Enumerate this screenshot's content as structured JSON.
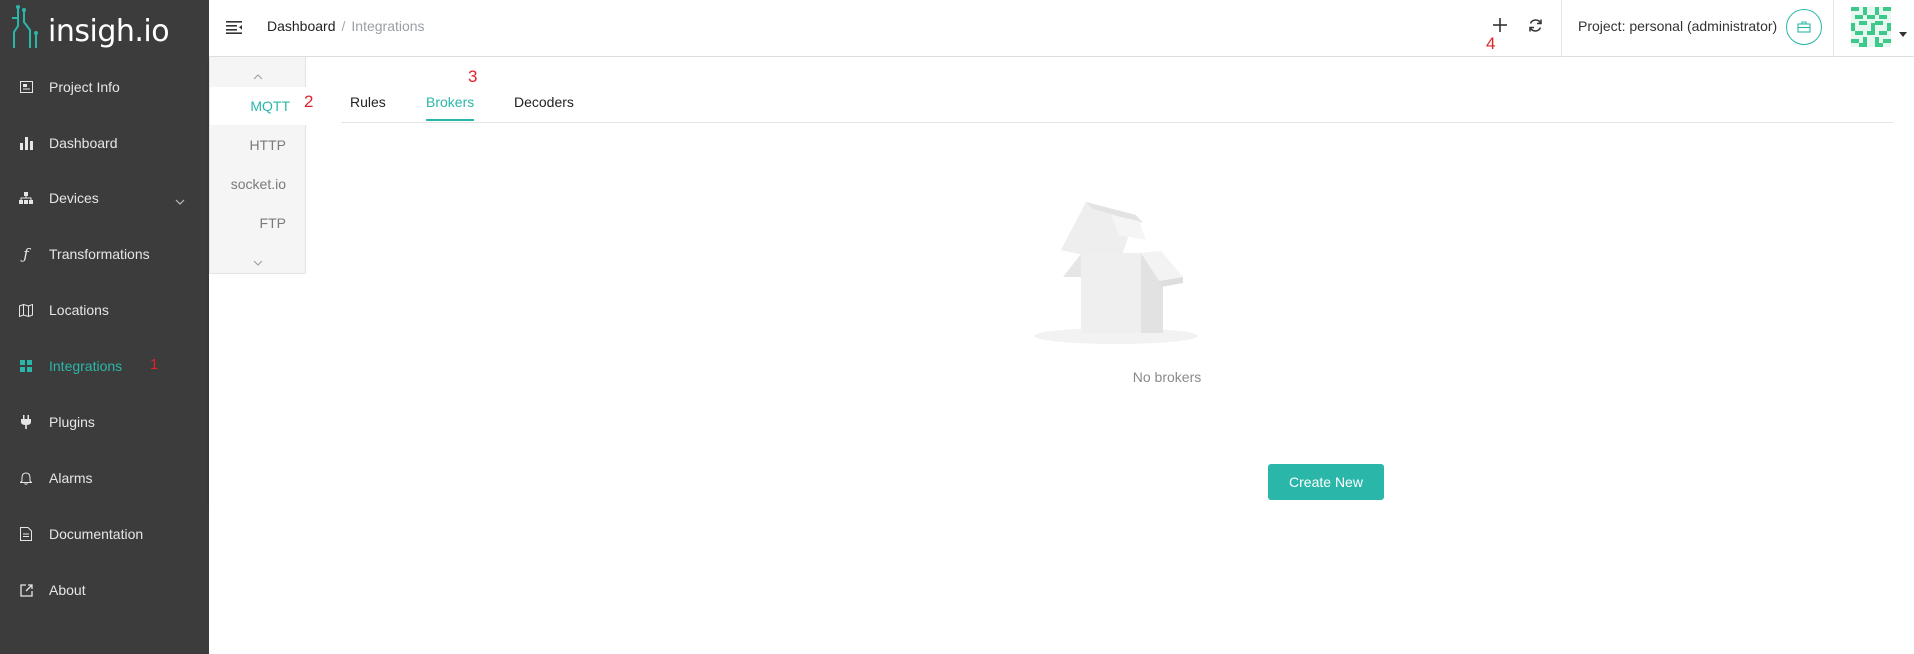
{
  "app": {
    "logo_text": "insigh.io"
  },
  "sidebar": {
    "items": [
      {
        "label": "Project Info",
        "icon": "project-info-icon"
      },
      {
        "label": "Dashboard",
        "icon": "bar-chart-icon"
      },
      {
        "label": "Devices",
        "icon": "devices-icon",
        "has_submenu": true
      },
      {
        "label": "Transformations",
        "icon": "function-icon"
      },
      {
        "label": "Locations",
        "icon": "map-icon"
      },
      {
        "label": "Integrations",
        "icon": "grid-icon",
        "active": true,
        "marker": "1"
      },
      {
        "label": "Plugins",
        "icon": "plug-icon"
      },
      {
        "label": "Alarms",
        "icon": "bell-icon"
      },
      {
        "label": "Documentation",
        "icon": "document-icon"
      },
      {
        "label": "About",
        "icon": "external-link-icon"
      }
    ]
  },
  "header": {
    "breadcrumb": {
      "root": "Dashboard",
      "separator": "/",
      "current": "Integrations"
    },
    "add_marker": "4",
    "project_label": "Project: personal (administrator)"
  },
  "vertical_tabs": {
    "items": [
      "MQTT",
      "HTTP",
      "socket.io",
      "FTP"
    ],
    "active": "MQTT",
    "marker": "2"
  },
  "tabs": {
    "items": [
      "Rules",
      "Brokers",
      "Decoders"
    ],
    "active": "Brokers",
    "marker": "3"
  },
  "empty_state": {
    "message": "No brokers",
    "button_label": "Create New"
  },
  "colors": {
    "accent": "#2ab7a9",
    "sidebar_bg": "#3c3c3c",
    "marker": "#e0232a"
  }
}
